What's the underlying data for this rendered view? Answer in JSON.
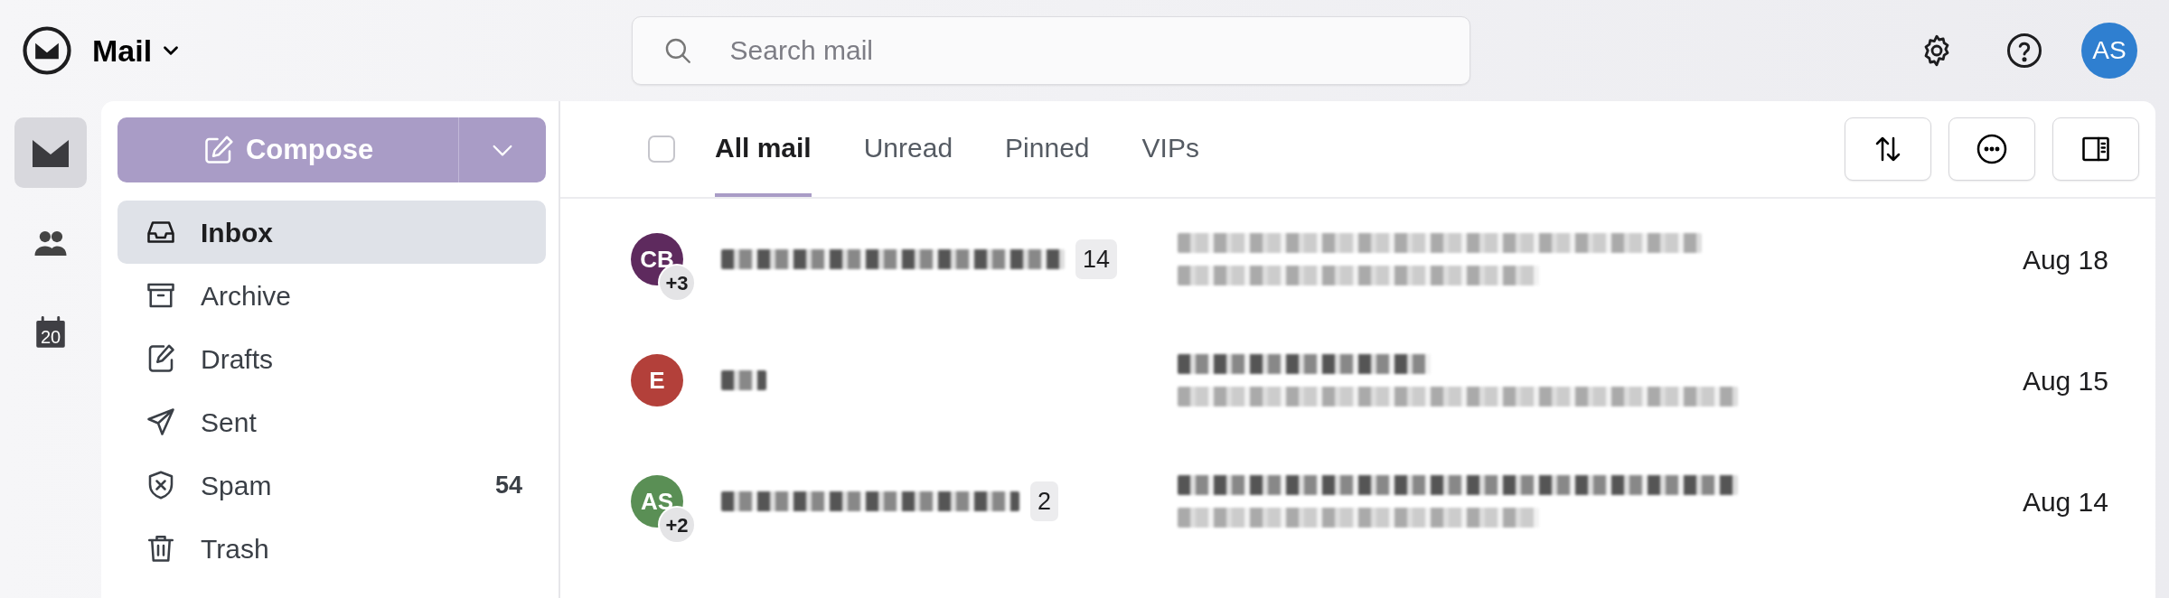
{
  "app": {
    "title": "Mail"
  },
  "search": {
    "placeholder": "Search mail"
  },
  "user": {
    "initials": "AS"
  },
  "rail": [
    {
      "kind": "mail",
      "selected": true
    },
    {
      "kind": "contacts",
      "selected": false
    },
    {
      "kind": "calendar",
      "selected": false,
      "day": "20"
    }
  ],
  "compose": {
    "label": "Compose"
  },
  "folders": [
    {
      "kind": "inbox",
      "label": "Inbox",
      "selected": true
    },
    {
      "kind": "archive",
      "label": "Archive",
      "selected": false
    },
    {
      "kind": "drafts",
      "label": "Drafts",
      "selected": false
    },
    {
      "kind": "sent",
      "label": "Sent",
      "selected": false
    },
    {
      "kind": "spam",
      "label": "Spam",
      "selected": false,
      "count": "54"
    },
    {
      "kind": "trash",
      "label": "Trash",
      "selected": false
    }
  ],
  "select_all": {
    "checked": false
  },
  "tabs": [
    {
      "label": "All mail",
      "selected": true
    },
    {
      "label": "Unread",
      "selected": false
    },
    {
      "label": "Pinned",
      "selected": false
    },
    {
      "label": "VIPs",
      "selected": false
    }
  ],
  "messages": [
    {
      "initials": "CB",
      "color": "#5e2a5e",
      "extra": "+3",
      "thread_count": "14",
      "date": "Aug 18"
    },
    {
      "initials": "E",
      "color": "#b3403a",
      "date": "Aug 15"
    },
    {
      "initials": "AS",
      "color": "#5a8f55",
      "extra": "+2",
      "thread_count": "2",
      "date": "Aug 14"
    }
  ]
}
